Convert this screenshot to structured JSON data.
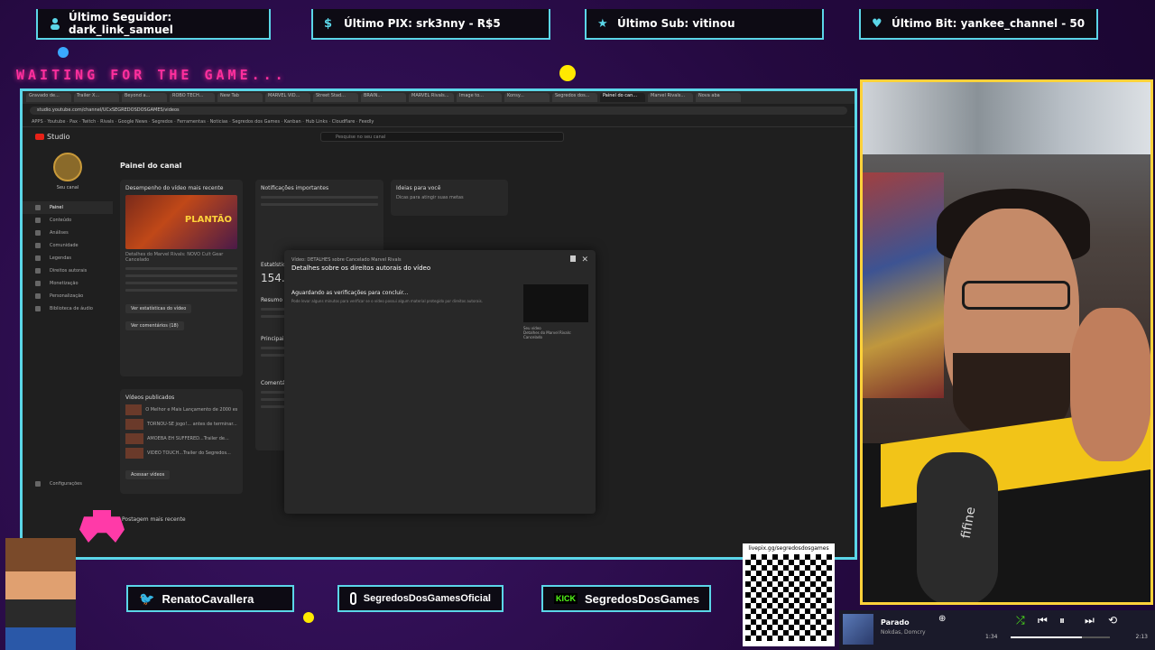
{
  "top_bars": [
    {
      "label": "Último Seguidor: dark_link_samuel",
      "icon": "user-icon",
      "color": "#5bd6e8"
    },
    {
      "label": "Último PIX: srk3nny - R$5",
      "icon": "dollar-icon",
      "color": "#5bd6e8"
    },
    {
      "label": "Último Sub: vitinou",
      "icon": "star-icon",
      "color": "#5bd6e8"
    },
    {
      "label": "Último Bit: yankee_channel - 50",
      "icon": "diamond-icon",
      "color": "#5bd6e8"
    }
  ],
  "waiting_text": "WAITING FOR THE GAME...",
  "browser": {
    "url": "studio.youtube.com/channel/UCxSEGREDOSDOSGAMES/videos",
    "tabs": [
      "Gravado de...",
      "Trailer X...",
      "Beyond a...",
      "ROBO TECH...",
      "New Tab",
      "MARVEL VID...",
      "Street Stad...",
      "BRAIN...",
      "MARVEL Rivals...",
      "Image to...",
      "Konsy...",
      "Segredos dos...",
      "Painel do can...",
      "Marvel Rivals...",
      "Nova aba"
    ],
    "bookmarks": "APPS  ·  Youtube  ·  Pax  ·  Twitch  ·  Rivals  ·  Google News  ·  Segredos  ·  Ferramentas  ·  Noticias  ·  Segredos dos Games  ·  Kanban  ·  Hub Links  ·  Cloudflare  ·  Feedly"
  },
  "studio": {
    "logo": "Studio",
    "search_placeholder": "Pesquise no seu canal",
    "channel_name": "Seu canal",
    "sidebar": [
      "Painel",
      "Conteúdo",
      "Análises",
      "Comunidade",
      "Legendas",
      "Direitos autorais",
      "Monetização",
      "Personalização",
      "Biblioteca de áudio"
    ],
    "settings_label": "Configurações",
    "page_title": "Painel do canal",
    "latest_video_title": "Desempenho do vídeo mais recente",
    "latest_video_caption": "Detalhes do Marvel Rivals: NOVO Cult Gear Cancelado",
    "thumb_text": "PLANTÃO",
    "stats_button": "Ver estatísticas do vídeo",
    "comments_button": "Ver comentários (18)",
    "published_title": "Vídeos publicados",
    "published_items": [
      "O Melhor e Mais Lançamento de 2000 está...",
      "TORNOU-SE jogo!... antes de terminar...",
      "AMOEBA EH SUFFERED...Trailer de...",
      "VÍDEO TOUCH...Trailer do Segredos..."
    ],
    "see_videos": "Acessar vídeos",
    "notifications_title": "Notificações importantes",
    "ideas_title": "Ideias para você",
    "ideas_sub": "Dicas para atingir suas metas",
    "stats_title": "Estatísticas do canal",
    "stats_value": "154.0",
    "summary_title": "Resumo",
    "main_title": "Principais vídeos",
    "comments_title": "Comentários recentes",
    "post_title": "Postagem mais recente"
  },
  "modal": {
    "subtitle": "Vídeo: DETALHES sobre Cancelado Marvel Rivals",
    "title": "Detalhes sobre os direitos autorais do vídeo",
    "wait": "Aguardando as verificações para concluir...",
    "desc": "Pode levar alguns minutos para verificar se o vídeo possui algum material protegido por direitos autorais.",
    "video_label": "Seu vídeo",
    "video_caption": "Detalhes do Marvel Rivals: Cancelado"
  },
  "social": {
    "twitter": "RenatoCavallera",
    "instagram": "SegredosDosGamesOficial",
    "kick": "SegredosDosGames",
    "qr_url": "livepix.gg/segredosdosgames"
  },
  "music": {
    "song": "Parado",
    "artist": "Nokdas, Domcry",
    "elapsed": "1:34",
    "total": "2:13",
    "progress": 0.72
  },
  "mic_brand": "fifine"
}
